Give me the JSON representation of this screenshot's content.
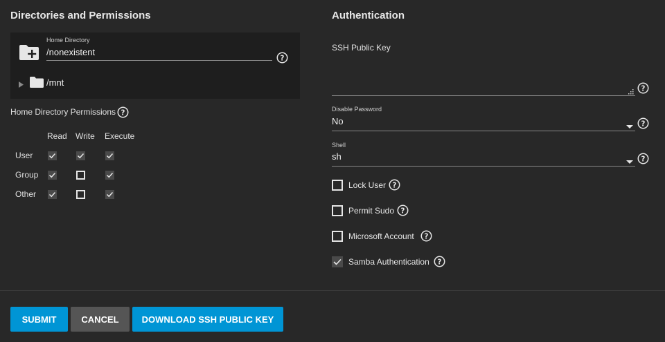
{
  "left": {
    "title": "Directories and Permissions",
    "home_dir": {
      "label": "Home Directory",
      "value": "/nonexistent",
      "tree_item": "/mnt"
    },
    "perm_title": "Home Directory Permissions",
    "columns": [
      "Read",
      "Write",
      "Execute"
    ],
    "rows": [
      {
        "label": "User",
        "checks": [
          true,
          true,
          true
        ]
      },
      {
        "label": "Group",
        "checks": [
          true,
          false,
          true
        ]
      },
      {
        "label": "Other",
        "checks": [
          true,
          false,
          true
        ]
      }
    ]
  },
  "right": {
    "title": "Authentication",
    "ssh_key_label": "SSH Public Key",
    "disable_password": {
      "label": "Disable Password",
      "value": "No"
    },
    "shell": {
      "label": "Shell",
      "value": "sh"
    },
    "checks": [
      {
        "label": "Lock User",
        "checked": false
      },
      {
        "label": "Permit Sudo",
        "checked": false
      },
      {
        "label": "Microsoft Account",
        "checked": false
      },
      {
        "label": "Samba Authentication",
        "checked": true
      }
    ]
  },
  "buttons": {
    "submit": "SUBMIT",
    "cancel": "CANCEL",
    "download": "DOWNLOAD SSH PUBLIC KEY"
  },
  "colors": {
    "background": "#282828",
    "panel": "#1e1e1e",
    "primary": "#0095d5",
    "secondary": "#555555"
  },
  "icons": {
    "help": "help-circle-icon",
    "folder_add": "folder-plus-icon",
    "folder": "folder-icon",
    "expand": "triangle-right-icon",
    "dropdown": "caret-down-icon",
    "resize": "resize-handle-icon"
  }
}
